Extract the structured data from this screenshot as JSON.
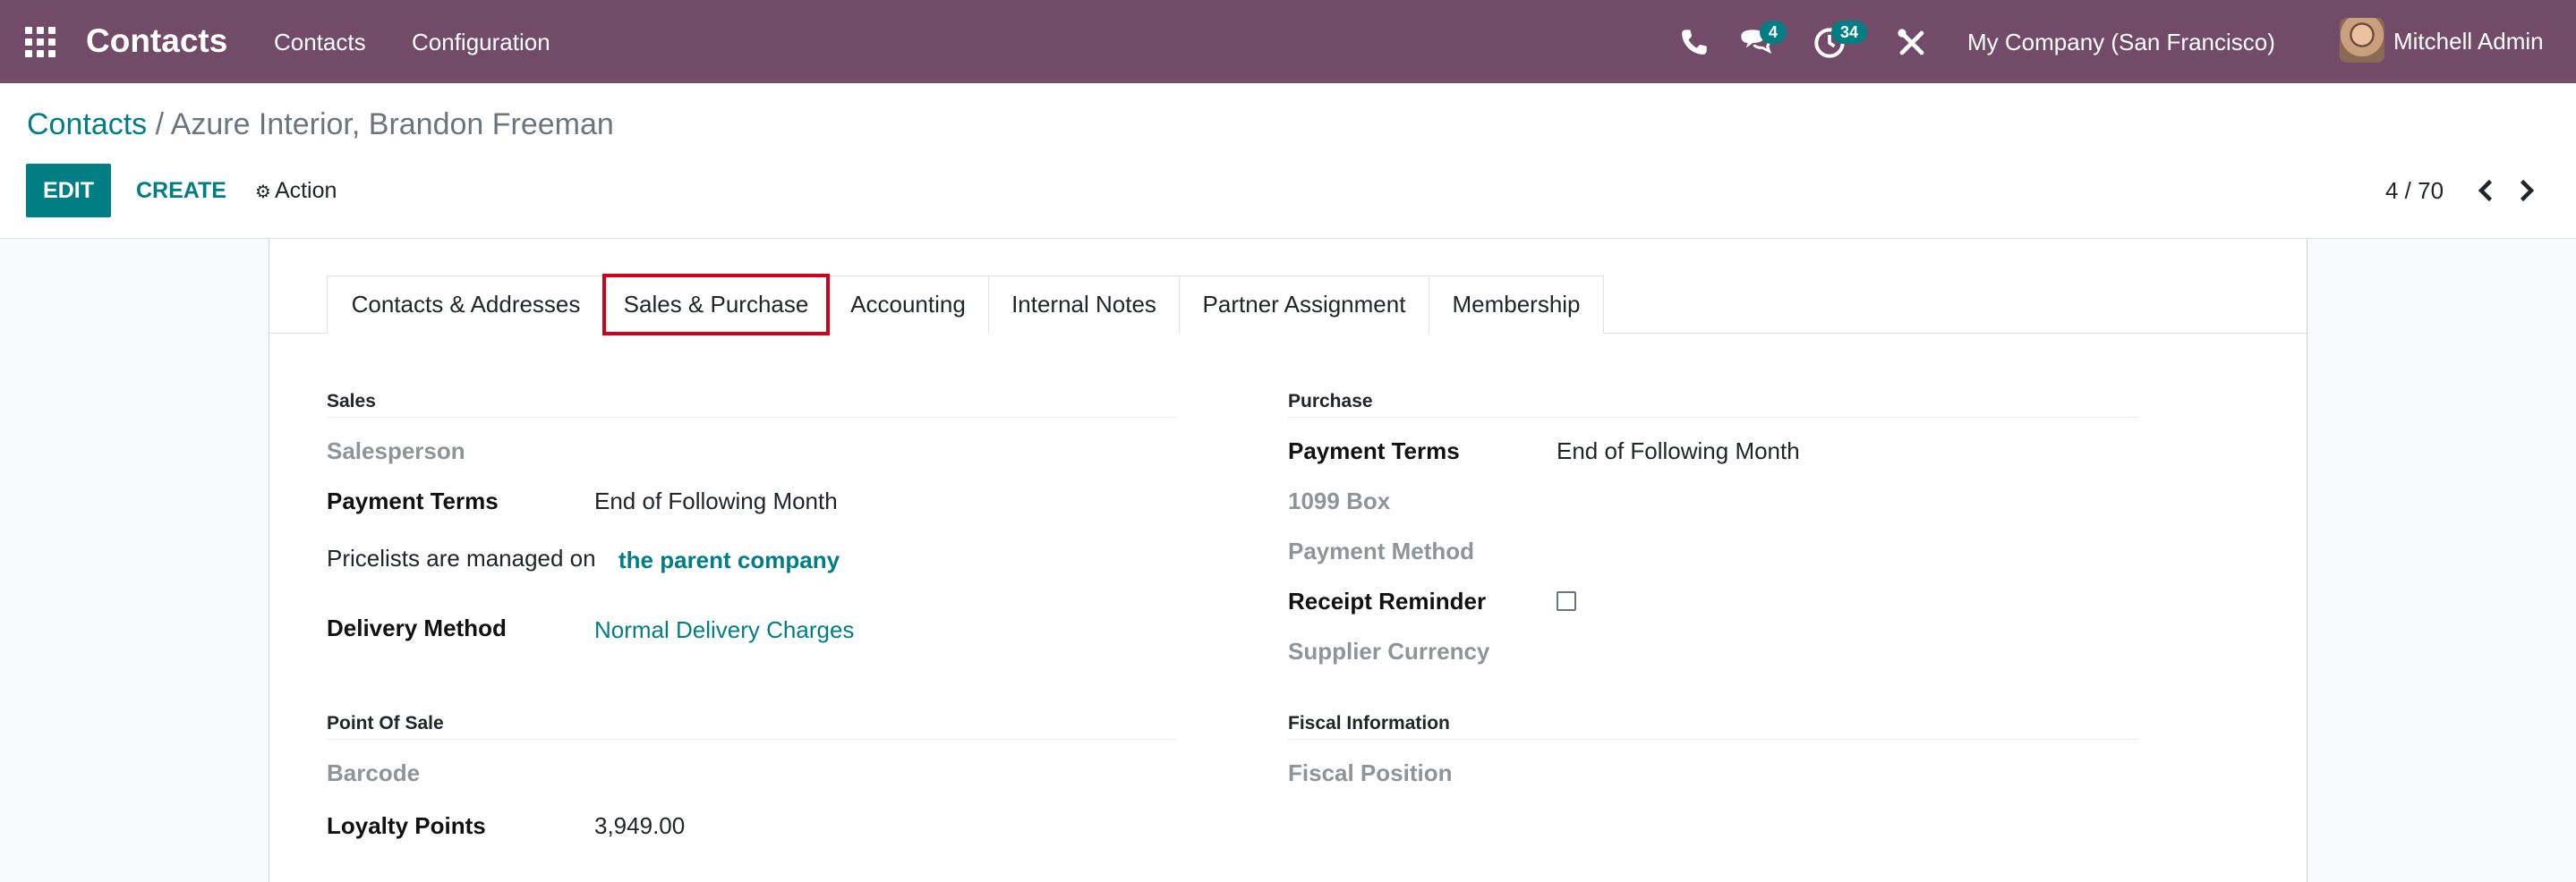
{
  "navbar": {
    "app_title": "Contacts",
    "menu": [
      "Contacts",
      "Configuration"
    ],
    "messages_count": "4",
    "activities_count": "34",
    "company": "My Company (San Francisco)",
    "user": "Mitchell Admin",
    "icons": [
      "apps-grid-icon",
      "phone-icon",
      "chat-icon",
      "clock-icon",
      "tools-icon"
    ]
  },
  "control": {
    "breadcrumb_root": "Contacts",
    "breadcrumb_sep": "/",
    "breadcrumb_current": "Azure Interior, Brandon Freeman",
    "edit_label": "EDIT",
    "create_label": "CREATE",
    "action_label": "Action",
    "pager": "4 / 70"
  },
  "tabs": [
    "Contacts & Addresses",
    "Sales & Purchase",
    "Accounting",
    "Internal Notes",
    "Partner Assignment",
    "Membership"
  ],
  "active_tab": "Sales & Purchase",
  "sales": {
    "title": "Sales",
    "salesperson_label": "Salesperson",
    "payment_terms_label": "Payment Terms",
    "payment_terms_value": "End of Following Month",
    "pricelist_label": "Pricelists are managed on",
    "pricelist_link": "the parent company",
    "delivery_label": "Delivery Method",
    "delivery_value": "Normal Delivery Charges"
  },
  "pos": {
    "title": "Point Of Sale",
    "barcode_label": "Barcode",
    "loyalty_label": "Loyalty Points",
    "loyalty_value": "3,949.00"
  },
  "purchase": {
    "title": "Purchase",
    "payment_terms_label": "Payment Terms",
    "payment_terms_value": "End of Following Month",
    "box_1099_label": "1099 Box",
    "payment_method_label": "Payment Method",
    "receipt_reminder_label": "Receipt Reminder",
    "receipt_reminder_checked": false,
    "supplier_currency_label": "Supplier Currency"
  },
  "fiscal": {
    "title": "Fiscal Information",
    "fiscal_position_label": "Fiscal Position"
  },
  "colors": {
    "navbar": "#714b67",
    "accent": "#017e84",
    "highlight": "#d0021b"
  }
}
